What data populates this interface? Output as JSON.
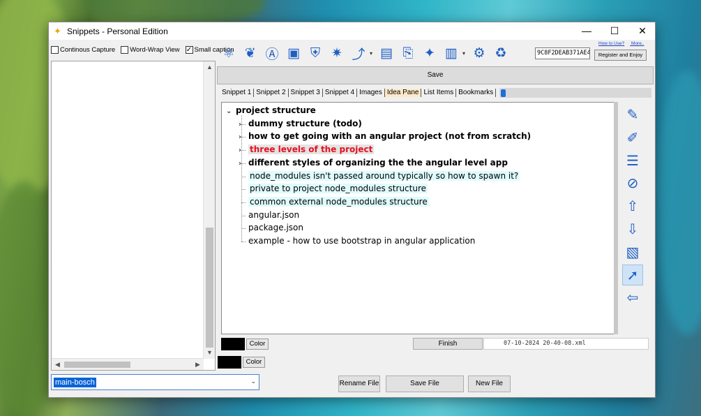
{
  "window": {
    "title": "Snippets - Personal Edition",
    "app_icon": "puzzle-star-icon",
    "controls": {
      "minimize": "—",
      "maximize": "☐",
      "close": "✕"
    }
  },
  "options": {
    "continuous_capture": {
      "label": "Continous Capture",
      "checked": false
    },
    "word_wrap": {
      "label": "Word-Wrap View",
      "checked": false
    },
    "small_caption": {
      "label": "Small caption",
      "checked": true,
      "mark": "✓"
    }
  },
  "toolbar": {
    "icons": [
      "translate-icon",
      "leaf-icon",
      "font-a-icon",
      "note-icon",
      "shield-check-icon",
      "fish-icon",
      "link-icon",
      "floppy-icon",
      "clipboard-icon",
      "bulb-icon",
      "book-icon",
      "gear-icon",
      "recycle-bin-icon"
    ],
    "glyphs": [
      "⚛",
      "❦",
      "Ⓐ",
      "▣",
      "⛨",
      "✷",
      "⤴",
      "▤",
      "⎘",
      "✦",
      "▥",
      "⚙",
      "♻"
    ],
    "dropdown_glyph": "▾",
    "serial": "9C8F2DEAB371AE4",
    "how_to_use": "How to Use?",
    "more": "More..",
    "register": "Register and Enjoy"
  },
  "save_label": "Save",
  "tabs": [
    {
      "label": "Snippet 1",
      "active": false
    },
    {
      "label": "Snippet 2",
      "active": false
    },
    {
      "label": "Snippet 3",
      "active": false
    },
    {
      "label": "Snippet 4",
      "active": false
    },
    {
      "label": "Images",
      "active": false
    },
    {
      "label": "Idea Pane",
      "active": true
    },
    {
      "label": "List Items",
      "active": false
    },
    {
      "label": "Bookmarks",
      "active": false
    }
  ],
  "tree": {
    "root": {
      "label": "project structure",
      "expander": "⌄"
    },
    "collapsed_expander": "›",
    "children": [
      {
        "label": "dummy structure (todo)",
        "bold": true,
        "expandable": true
      },
      {
        "label": "how to get going with an angular project (not from scratch)",
        "bold": true,
        "expandable": true
      },
      {
        "label": "three levels of the project",
        "bold": true,
        "expandable": true,
        "highlight": "gray",
        "color": "#e8101e"
      },
      {
        "label": "different styles of organizing the the angular level app",
        "bold": true,
        "expandable": true
      },
      {
        "label": "node_modules isn't passed around typically so how to spawn it?",
        "bold": false,
        "expandable": false,
        "highlight": "cyan"
      },
      {
        "label": "private to project node_modules structure",
        "bold": false,
        "expandable": false,
        "highlight": "cyan"
      },
      {
        "label": "common external node_modules structure",
        "bold": false,
        "expandable": false,
        "highlight": "cyan"
      },
      {
        "label": "angular.json",
        "bold": false,
        "expandable": false
      },
      {
        "label": "package.json",
        "bold": false,
        "expandable": false
      },
      {
        "label": "example - how to use bootstrap in angular application",
        "bold": false,
        "expandable": false
      }
    ]
  },
  "side_icons": [
    {
      "name": "add-node-icon",
      "glyph": "✎"
    },
    {
      "name": "add-child-icon",
      "glyph": "✐"
    },
    {
      "name": "edit-lines-icon",
      "glyph": "☰"
    },
    {
      "name": "delete-icon",
      "glyph": "⊘"
    },
    {
      "name": "move-up-icon",
      "glyph": "⇧"
    },
    {
      "name": "move-down-icon",
      "glyph": "⇩"
    },
    {
      "name": "picture-icon",
      "glyph": "▧"
    },
    {
      "name": "cursor-select-icon",
      "glyph": "➚",
      "selected": true
    },
    {
      "name": "back-arrow-icon",
      "glyph": "⇦"
    }
  ],
  "color_label": "Color",
  "finish_label": "Finish",
  "timestamp": "07-10-2024 20-40-08.xml",
  "file": {
    "selected": "main-bosch",
    "rename": "Rename File",
    "save": "Save File",
    "new": "New File"
  },
  "scroll_glyphs": {
    "up": "▲",
    "down": "▼",
    "left": "◀",
    "right": "▶",
    "dropdown": "⌄"
  }
}
